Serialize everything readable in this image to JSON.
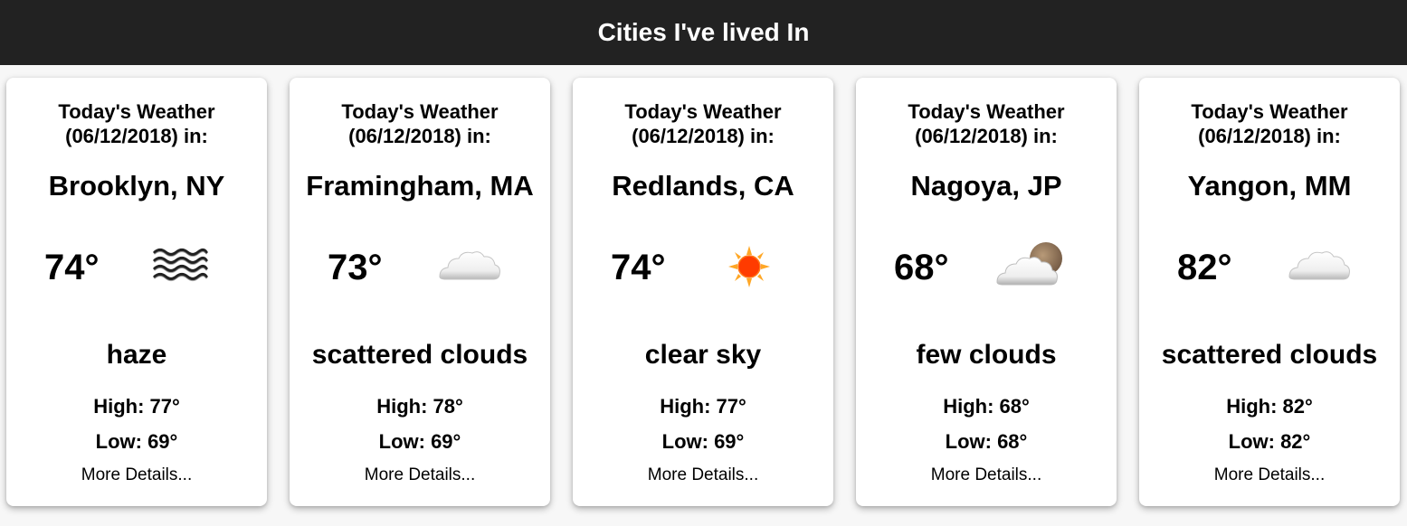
{
  "header": {
    "title": "Cities I've lived In"
  },
  "cards": [
    {
      "today_line1": "Today's Weather",
      "today_line2": "(06/12/2018) in:",
      "city": "Brooklyn, NY",
      "temp": "74°",
      "icon": "haze-icon",
      "description": "haze",
      "high": "High: 77°",
      "low": "Low: 69°",
      "more": "More Details..."
    },
    {
      "today_line1": "Today's Weather",
      "today_line2": "(06/12/2018) in:",
      "city": "Framingham, MA",
      "temp": "73°",
      "icon": "cloud-icon",
      "description": "scattered clouds",
      "high": "High: 78°",
      "low": "Low: 69°",
      "more": "More Details..."
    },
    {
      "today_line1": "Today's Weather",
      "today_line2": "(06/12/2018) in:",
      "city": "Redlands, CA",
      "temp": "74°",
      "icon": "sun-icon",
      "description": "clear sky",
      "high": "High: 77°",
      "low": "Low: 69°",
      "more": "More Details..."
    },
    {
      "today_line1": "Today's Weather",
      "today_line2": "(06/12/2018) in:",
      "city": "Nagoya, JP",
      "temp": "68°",
      "icon": "cloud-moon-icon",
      "description": "few clouds",
      "high": "High: 68°",
      "low": "Low: 68°",
      "more": "More Details..."
    },
    {
      "today_line1": "Today's Weather",
      "today_line2": "(06/12/2018) in:",
      "city": "Yangon, MM",
      "temp": "82°",
      "icon": "cloud-icon",
      "description": "scattered clouds",
      "high": "High: 82°",
      "low": "Low: 82°",
      "more": "More Details..."
    }
  ],
  "colors": {
    "header_bg": "#222222",
    "header_text": "#ffffff",
    "card_bg": "#ffffff",
    "sun": "#ff3b00",
    "sun_rays": "#ffa726"
  }
}
